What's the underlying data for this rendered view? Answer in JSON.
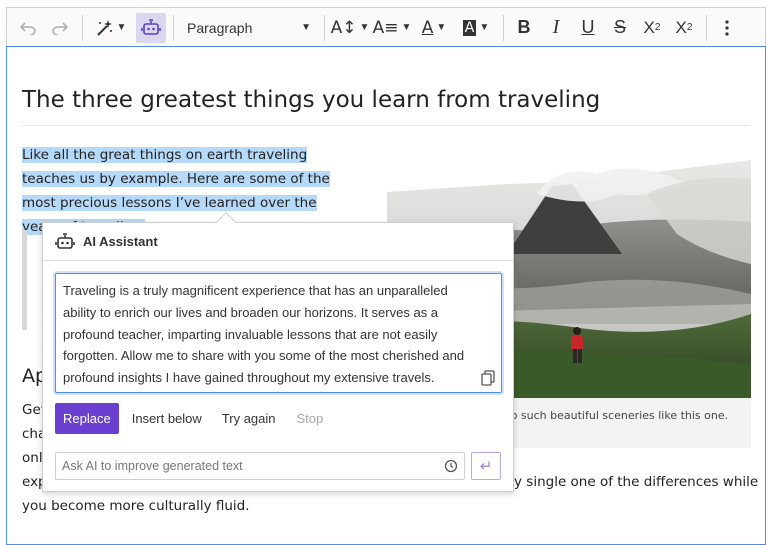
{
  "toolbar": {
    "undo_icon": "undo-icon",
    "redo_icon": "redo-icon",
    "magic_icon": "magic-wand-icon",
    "ai_icon": "robot-icon",
    "paragraph_label": "Paragraph",
    "font_size_glyph": "AI",
    "font_family_glyph": "A",
    "font_color_glyph": "A",
    "bg_color_glyph": "A",
    "bold": "B",
    "italic": "I",
    "underline": "U",
    "strike": "S",
    "subscript": "X",
    "subscript_sub": "2",
    "superscript": "X",
    "superscript_sup": "2",
    "more_icon": "more-vertical-icon",
    "accent_color": "#6b3fcf"
  },
  "document": {
    "title": "The three greatest things you learn from traveling",
    "intro": "Like all the great things on earth traveling teaches us by example. Here are some of the most precious lessons I’ve learned over the years of traveling.",
    "image_caption_visible": "e might lead you to such beautiful sceneries like this one.",
    "heading_partial": "Ap",
    "body_lines": [
      "Get",
      "cha",
      "onl",
      "exp",
      "you become more culturally fluid."
    ],
    "body_line4_tail": "y single one of the differences while"
  },
  "ai_panel": {
    "title": "AI Assistant",
    "response": "Traveling is a truly magnificent experience that has an unparalleled ability to enrich our lives and broaden our horizons. It serves as a profound teacher, imparting invaluable lessons that are not easily forgotten. Allow me to share with you some of the most cherished and profound insights I have gained throughout my extensive travels.",
    "replace_label": "Replace",
    "insert_below_label": "Insert below",
    "try_again_label": "Try again",
    "stop_label": "Stop",
    "input_placeholder": "Ask AI to improve generated text",
    "submit_glyph": "↵"
  }
}
